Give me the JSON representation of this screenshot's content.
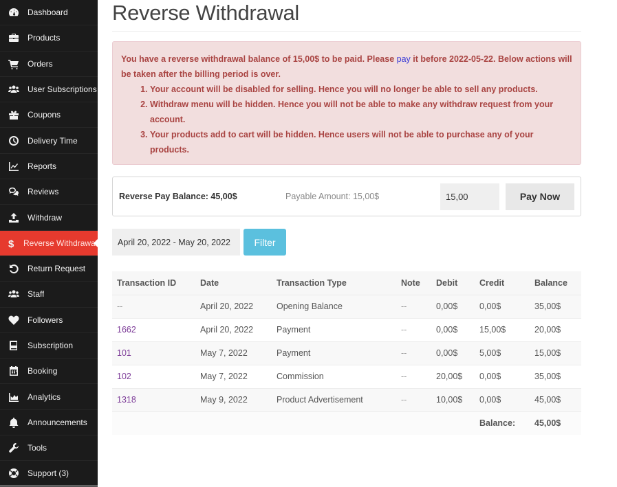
{
  "sidebar": {
    "items": [
      {
        "label": "Dashboard",
        "icon": "tachometer-icon"
      },
      {
        "label": "Products",
        "icon": "briefcase-icon"
      },
      {
        "label": "Orders",
        "icon": "cart-icon"
      },
      {
        "label": "User Subscriptions",
        "icon": "users-icon"
      },
      {
        "label": "Coupons",
        "icon": "gift-icon"
      },
      {
        "label": "Delivery Time",
        "icon": "clock-icon"
      },
      {
        "label": "Reports",
        "icon": "line-chart-icon"
      },
      {
        "label": "Reviews",
        "icon": "comments-icon"
      },
      {
        "label": "Withdraw",
        "icon": "upload-icon"
      },
      {
        "label": "Reverse Withdrawal",
        "icon": "dollar-icon",
        "active": true
      },
      {
        "label": "Return Request",
        "icon": "undo-icon"
      },
      {
        "label": "Staff",
        "icon": "users-icon"
      },
      {
        "label": "Followers",
        "icon": "heart-icon"
      },
      {
        "label": "Subscription",
        "icon": "book-icon"
      },
      {
        "label": "Booking",
        "icon": "calendar-icon"
      },
      {
        "label": "Analytics",
        "icon": "area-chart-icon"
      },
      {
        "label": "Announcements",
        "icon": "bell-icon"
      },
      {
        "label": "Tools",
        "icon": "wrench-icon"
      },
      {
        "label": "Support (3)",
        "icon": "life-ring-icon"
      }
    ],
    "active_color": "#e63a2e",
    "background": "#1b1b1b"
  },
  "page": {
    "title": "Reverse Withdrawal"
  },
  "alert": {
    "text_before_link": "You have a reverse withdrawal balance of 15,00$ to be paid. Please ",
    "link_text": "pay",
    "text_after_link": " it before 2022-05-22. Below actions will be taken after the billing period is over.",
    "items": [
      "Your account will be disabled for selling. Hence you will no longer be able to sell any products.",
      "Withdraw menu will be hidden. Hence you will not be able to make any withdraw request from your account.",
      "Your products add to cart will be hidden. Hence users will not be able to purchase any of your products."
    ]
  },
  "pay_box": {
    "balance_label": "Reverse Pay Balance: 45,00$",
    "payable_label": "Payable Amount: 15,00$",
    "amount_value": "15,00",
    "pay_button": "Pay Now"
  },
  "filter": {
    "date_range": "April 20, 2022 - May 20, 2022",
    "button": "Filter",
    "button_color": "#5bc0de"
  },
  "table": {
    "headers": [
      "Transaction ID",
      "Date",
      "Transaction Type",
      "Note",
      "Debit",
      "Credit",
      "Balance"
    ],
    "rows": [
      {
        "id": "--",
        "date": "April 20, 2022",
        "type": "Opening Balance",
        "note": "--",
        "debit": "0,00$",
        "credit": "0,00$",
        "balance": "35,00$"
      },
      {
        "id": "1662",
        "date": "April 20, 2022",
        "type": "Payment",
        "note": "--",
        "debit": "0,00$",
        "credit": "15,00$",
        "balance": "20,00$"
      },
      {
        "id": "101",
        "date": "May 7, 2022",
        "type": "Payment",
        "note": "--",
        "debit": "0,00$",
        "credit": "5,00$",
        "balance": "15,00$"
      },
      {
        "id": "102",
        "date": "May 7, 2022",
        "type": "Commission",
        "note": "--",
        "debit": "20,00$",
        "credit": "0,00$",
        "balance": "35,00$"
      },
      {
        "id": "1318",
        "date": "May 9, 2022",
        "type": "Product Advertisement",
        "note": "--",
        "debit": "10,00$",
        "credit": "0,00$",
        "balance": "45,00$"
      }
    ],
    "total_label": "Balance:",
    "total_value": "45,00$"
  }
}
